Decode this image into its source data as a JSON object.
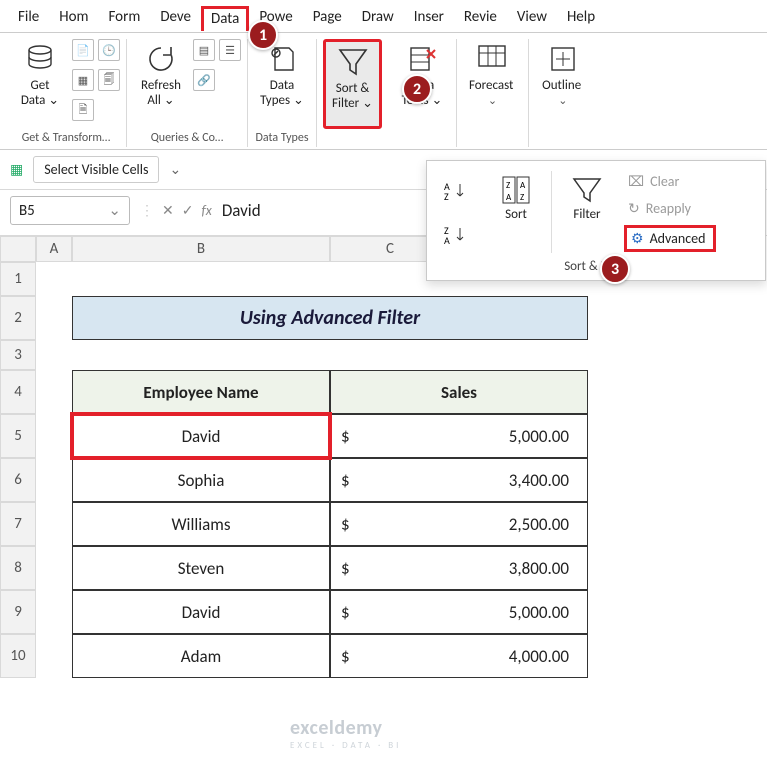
{
  "menu": [
    "File",
    "Hom",
    "Form",
    "Deve",
    "Data",
    "Powe",
    "Page",
    "Draw",
    "Inser",
    "Revie",
    "View",
    "Help"
  ],
  "ribbon": {
    "groups": {
      "getTransform": {
        "label": "Get & Transform…",
        "btn": "Get\nData"
      },
      "queries": {
        "label": "Queries & Co…",
        "btn": "Refresh\nAll"
      },
      "dataTypes": {
        "label": "Data Types",
        "btn": "Data\nTypes"
      },
      "sortFilter": {
        "btn": "Sort &\nFilter"
      },
      "dataTools": {
        "btn": "Data\nTools"
      },
      "forecast": {
        "btn": "Forecast"
      },
      "outline": {
        "btn": "Outline"
      }
    }
  },
  "qat": {
    "selectVisible": "Select Visible Cells"
  },
  "namebox": "B5",
  "formulaValue": "David",
  "dropdown": {
    "sortAsc": "A→Z",
    "sortDesc": "Z→A",
    "sort": "Sort",
    "filter": "Filter",
    "clear": "Clear",
    "reapply": "Reapply",
    "advanced": "Advanced",
    "footer": "Sort & Filter"
  },
  "table": {
    "title": "Using Advanced Filter",
    "headers": {
      "name": "Employee Name",
      "sales": "Sales"
    },
    "rows": [
      {
        "name": "David",
        "sales": "5,000.00"
      },
      {
        "name": "Sophia",
        "sales": "3,400.00"
      },
      {
        "name": "Williams",
        "sales": "2,500.00"
      },
      {
        "name": "Steven",
        "sales": "3,800.00"
      },
      {
        "name": "David",
        "sales": "5,000.00"
      },
      {
        "name": "Adam",
        "sales": "4,000.00"
      }
    ]
  },
  "badges": {
    "b1": "1",
    "b2": "2",
    "b3": "3"
  },
  "watermark": {
    "main": "exceldemy",
    "sub": "EXCEL · DATA · BI"
  },
  "colLetters": [
    "A",
    "B",
    "C"
  ],
  "rowNums": [
    "1",
    "2",
    "3",
    "4",
    "5",
    "6",
    "7",
    "8",
    "9",
    "10"
  ]
}
